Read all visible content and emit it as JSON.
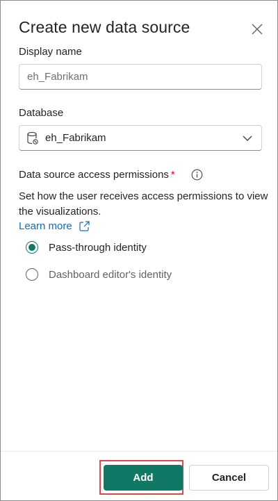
{
  "dialog": {
    "title": "Create new data source",
    "close_icon": "close-icon"
  },
  "display_name": {
    "label": "Display name",
    "placeholder": "eh_Fabrikam",
    "value": ""
  },
  "database": {
    "label": "Database",
    "icon": "database-icon",
    "selected": "eh_Fabrikam"
  },
  "permissions": {
    "label": "Data source access permissions",
    "required_marker": "*",
    "info_icon": "info-icon",
    "description": "Set how the user receives access permissions to view the visualizations.",
    "learn_more": "Learn more",
    "options": [
      {
        "label": "Pass-through identity",
        "checked": true
      },
      {
        "label": "Dashboard editor's identity",
        "checked": false
      }
    ]
  },
  "footer": {
    "add_label": "Add",
    "cancel_label": "Cancel"
  },
  "colors": {
    "accent": "#117865",
    "link": "#0f6cbd",
    "required": "#c50f1f",
    "highlight": "#e0454a"
  }
}
